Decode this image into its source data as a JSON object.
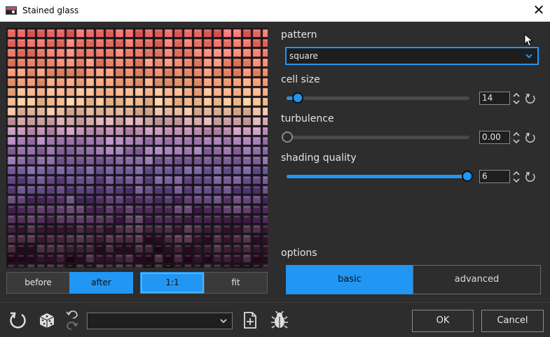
{
  "window": {
    "title": "Stained glass"
  },
  "view_toggle": {
    "before": "before",
    "after": "after",
    "one_to_one": "1:1",
    "fit": "fit"
  },
  "pattern": {
    "label": "pattern",
    "value": "square"
  },
  "cell_size": {
    "label": "cell size",
    "value": "14",
    "level": 0.03
  },
  "turbulence": {
    "label": "turbulence",
    "value": "0.00",
    "level": 0.0
  },
  "shading_quality": {
    "label": "shading quality",
    "value": "6",
    "level": 1.0
  },
  "options": {
    "label": "options",
    "basic": "basic",
    "advanced": "advanced"
  },
  "buttons": {
    "ok": "OK",
    "cancel": "Cancel"
  },
  "preset": {
    "value": ""
  },
  "colors": {
    "accent": "#2196f3",
    "background": "#2d2d2d"
  },
  "icons": [
    "app-icon",
    "close-icon",
    "chevron-down-icon",
    "reset-icon",
    "dice-icon",
    "undo-icon",
    "redo-icon",
    "add-preset-icon",
    "bug-icon"
  ]
}
